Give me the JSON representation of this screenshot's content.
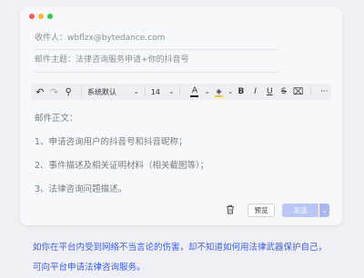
{
  "window": {
    "dots": [
      {
        "name": "close-dot",
        "color": "#f25c54"
      },
      {
        "name": "minimize-dot",
        "color": "#f5b63a"
      },
      {
        "name": "maximize-dot",
        "color": "#33c748"
      }
    ]
  },
  "compose": {
    "to_label": "收件人：",
    "to_value": "wbflzx@bytedance.com",
    "subject_label": "邮件主题：",
    "subject_value": "法律咨询服务申请+你的抖音号"
  },
  "toolbar": {
    "undo_icon": "↶",
    "redo_icon": "↷",
    "format_painter_icon": "⚲",
    "font_family": "系统默认",
    "font_size": "14",
    "text_color_icon": "A",
    "text_color": "#222222",
    "highlight_icon": "◈",
    "highlight_color": "#f5c842",
    "bold": "B",
    "italic": "I",
    "underline": "U",
    "strikethrough": "S",
    "more": "···",
    "caret": "⌄"
  },
  "body": {
    "lines": [
      "邮件正文：",
      "1、申请咨询用户的抖音号和抖音昵称；",
      "2、事件描述及相关证明材料（相关截图等）；",
      "3、法律咨询问题描述。"
    ]
  },
  "actions": {
    "trash_icon": "🗑",
    "preview_label": "预览",
    "send_label": "发送",
    "send_caret": "⌄"
  },
  "footer": {
    "text_line1": "如你在平台内受到网络不当言论的伤害，却不知道如何用法律武器保护自己，",
    "text_line2": "可向平台申请法律咨询服务。"
  },
  "colors": {
    "accent": "#3e5ce6",
    "send_bg": "#b9c6f6"
  }
}
